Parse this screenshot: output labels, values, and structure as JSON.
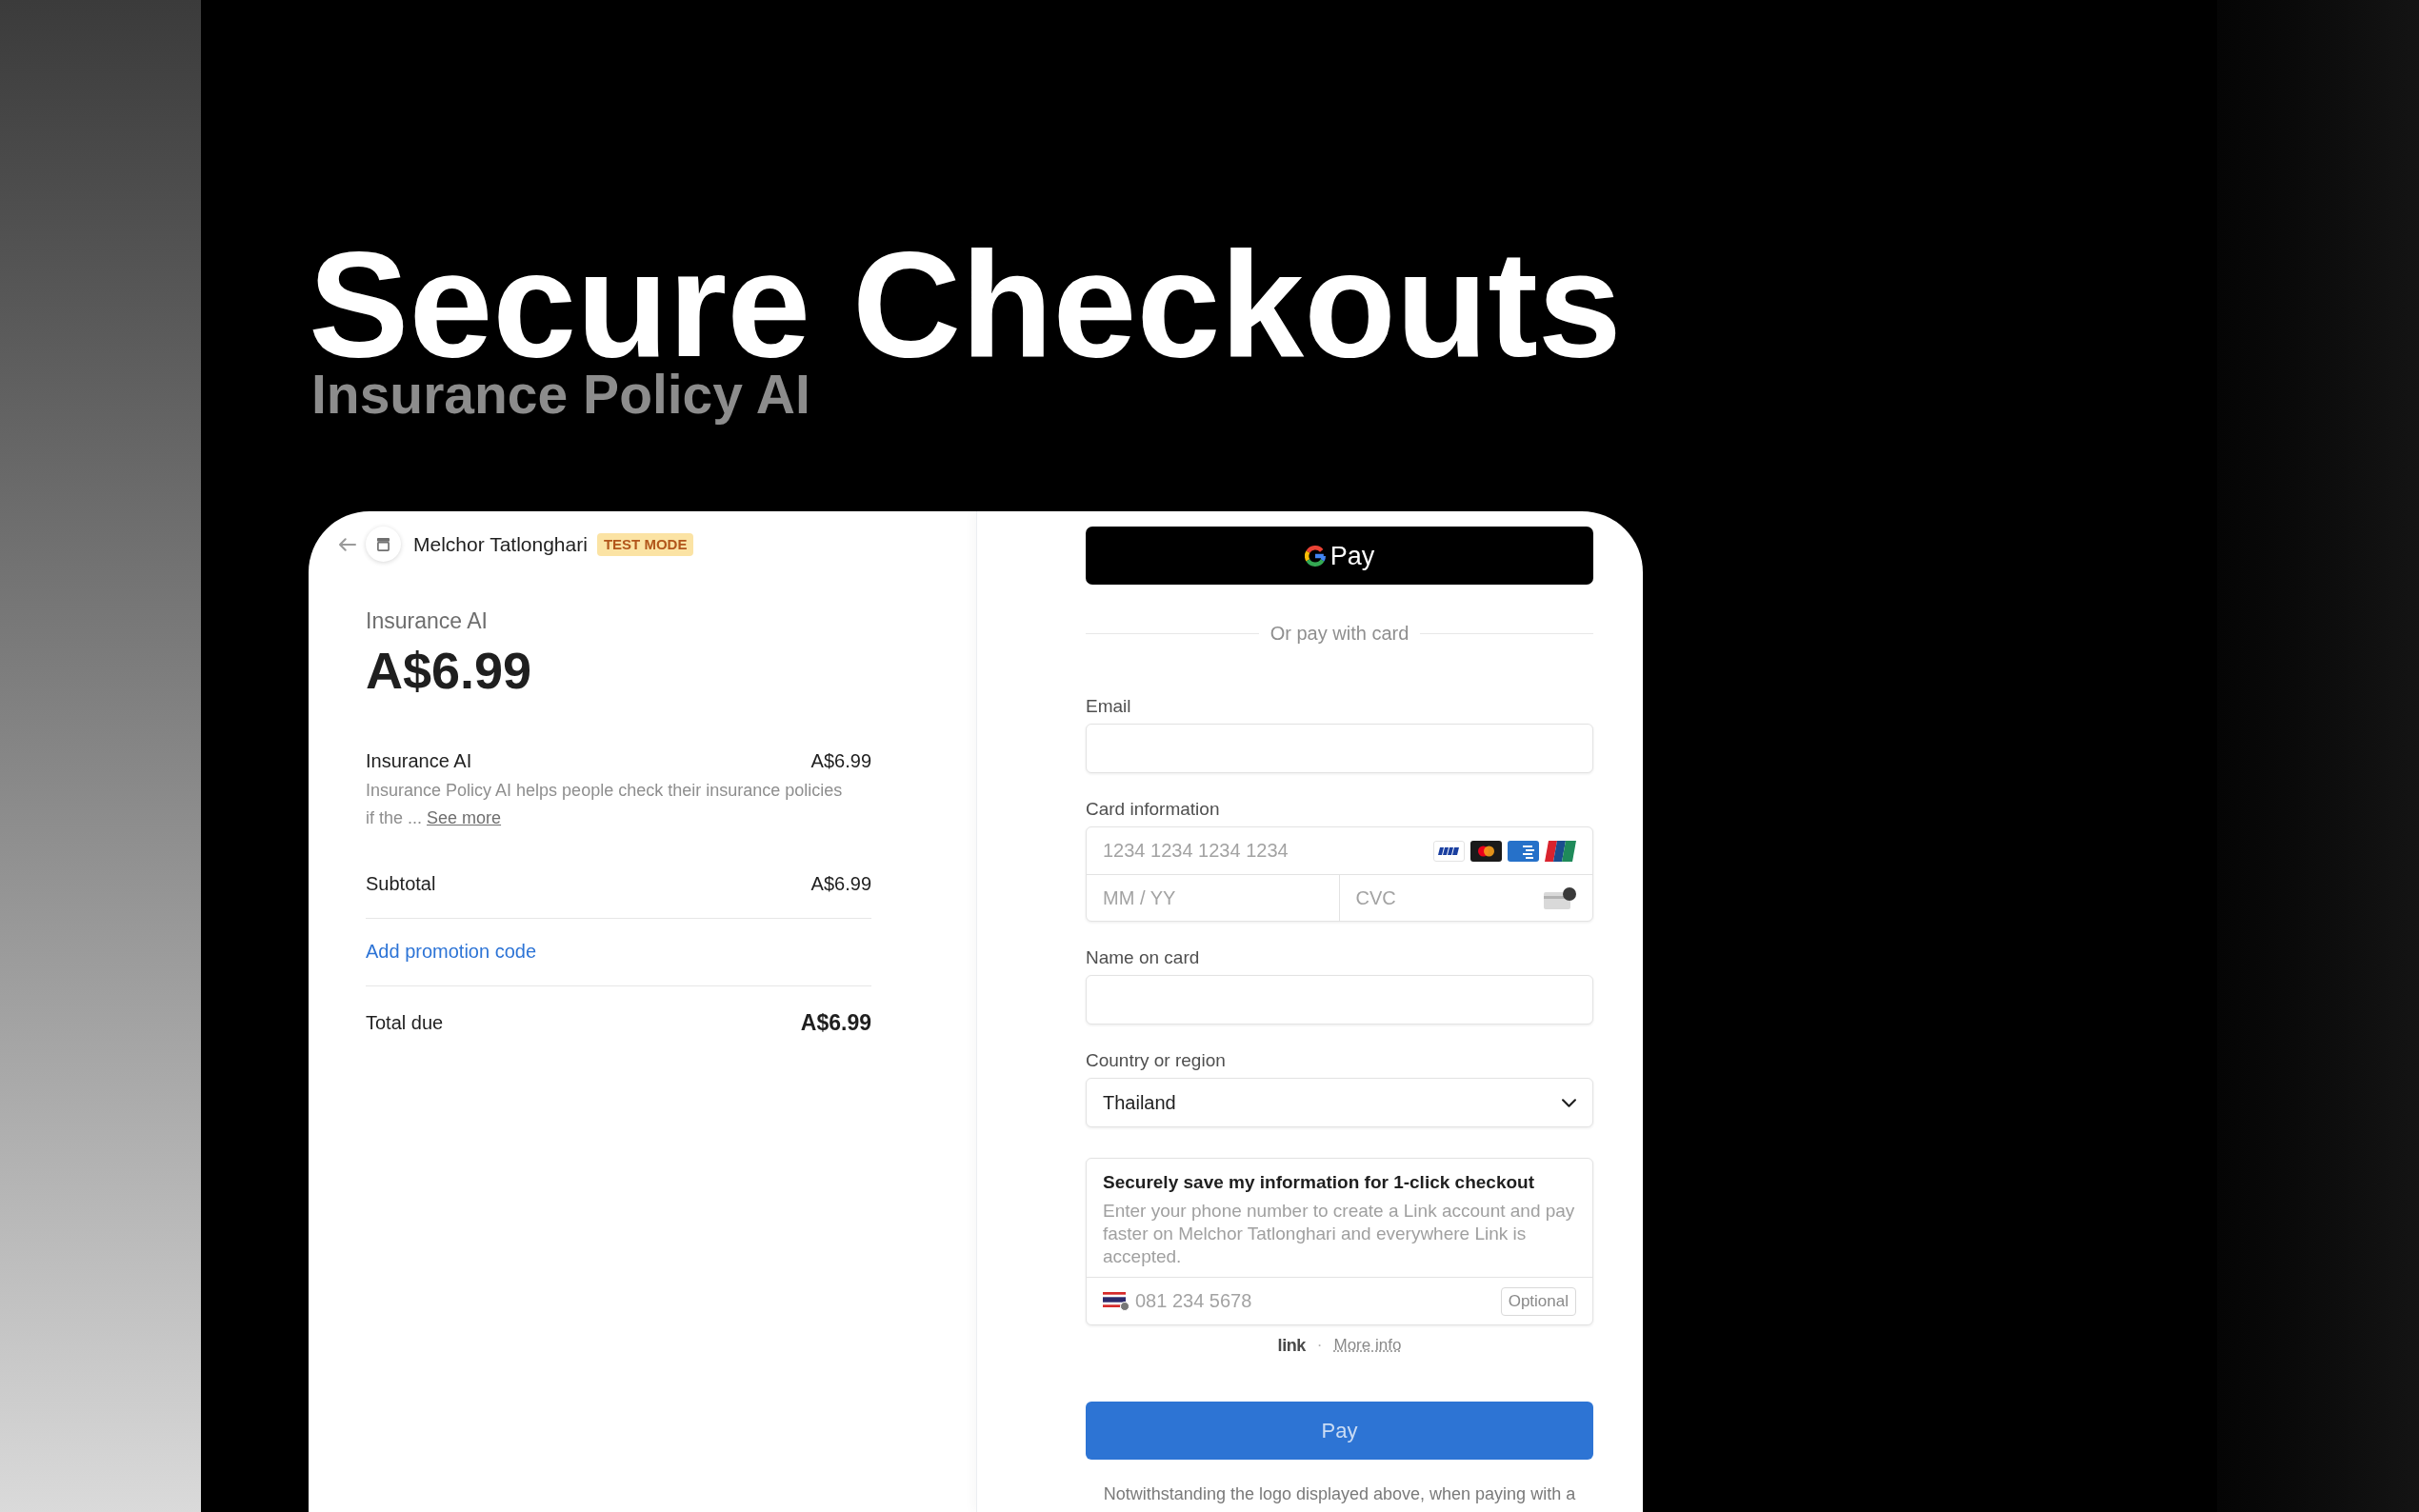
{
  "hero": {
    "title": "Secure Checkouts",
    "subtitle": "Insurance Policy AI"
  },
  "checkout": {
    "header": {
      "merchant": "Melchor Tatlonghari",
      "badge": "TEST MODE"
    },
    "summary": {
      "product": "Insurance AI",
      "price": "A$6.99",
      "line_items": [
        {
          "name": "Insurance AI",
          "price": "A$6.99",
          "description": "Insurance Policy AI helps people check their insurance policies if the ...",
          "more_link": "See more"
        }
      ],
      "subtotal": {
        "label": "Subtotal",
        "value": "A$6.99"
      },
      "promotion_link": "Add promotion code",
      "total": {
        "label": "Total due",
        "value": "A$6.99"
      }
    },
    "payment": {
      "wallet_button": {
        "label": "Pay"
      },
      "divider": "Or pay with card",
      "fields": [
        {
          "kind": "text",
          "label": "Email"
        },
        {
          "kind": "card",
          "label": "Card information",
          "number_placeholder": "1234 1234 1234 1234",
          "expiry_placeholder": "MM / YY",
          "cvc_placeholder": "CVC"
        },
        {
          "kind": "text",
          "label": "Name on card"
        },
        {
          "kind": "select",
          "label": "Country or region",
          "value": "Thailand"
        }
      ],
      "save_info": {
        "title": "Securely save my information for 1-click checkout",
        "description": "Enter your phone number to create a Link account and pay faster on Melchor Tatlonghari and everywhere Link is accepted.",
        "phone_placeholder": "081 234 5678",
        "optional_tag": "Optional"
      },
      "link_footer": {
        "logo": "link",
        "separator": "·",
        "more_info": "More info"
      },
      "pay_button": {
        "label": "Pay",
        "disabled": true
      },
      "notice": "Notwithstanding the logo displayed above, when paying with a"
    }
  }
}
